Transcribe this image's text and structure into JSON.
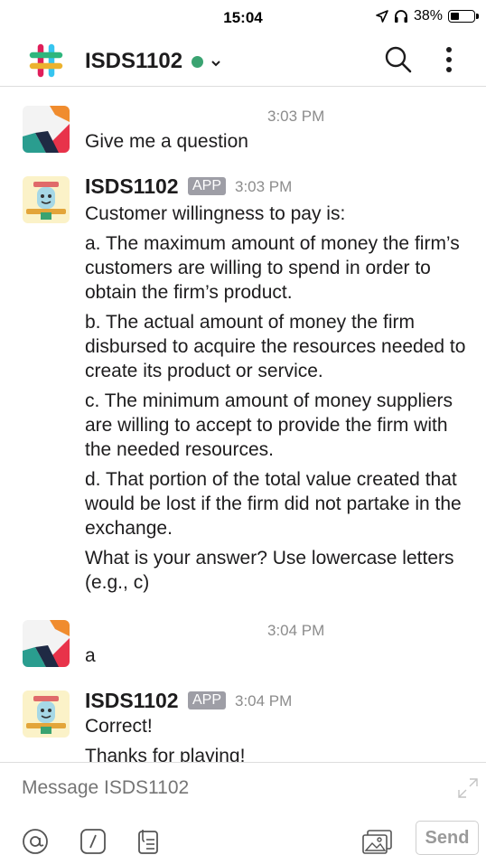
{
  "status_bar": {
    "time": "15:04",
    "battery_text": "38%",
    "battery_level": 0.38,
    "icons": [
      "location-arrow-icon",
      "headphones-icon",
      "battery-icon"
    ]
  },
  "header": {
    "channel_name": "ISDS1102",
    "presence": "online",
    "presence_color": "#3aa371",
    "chevron": "⌄",
    "icons": [
      "slack-logo-icon",
      "chevron-down-icon",
      "search-icon",
      "more-vertical-icon"
    ]
  },
  "messages": [
    {
      "sender": "",
      "time": "3:03 PM",
      "paragraphs": [
        "Give me a question"
      ],
      "avatar": "user-avatar-icon"
    },
    {
      "sender": "ISDS1102",
      "badge": "APP",
      "time": "3:03 PM",
      "avatar": "bot-avatar-icon",
      "paragraphs": [
        "Customer willingness to pay is:",
        "a. The maximum amount of money the firm’s customers are willing to spend in order to obtain the firm’s product.",
        "b. The actual amount of money the firm disbursed to acquire the resources needed to create its product or service.",
        "c. The minimum amount of money suppliers are willing to accept to provide the firm with the needed resources.",
        "d. That portion of the total value created that would be lost if the firm did not partake in the exchange.",
        "What is your answer? Use lowercase letters (e.g., c)"
      ]
    },
    {
      "sender": "",
      "time": "3:04 PM",
      "paragraphs": [
        "a"
      ],
      "avatar": "user-avatar-icon"
    },
    {
      "sender": "ISDS1102",
      "badge": "APP",
      "time": "3:04 PM",
      "avatar": "bot-avatar-icon",
      "paragraphs": [
        "Correct!",
        "Thanks for playing!"
      ]
    }
  ],
  "composer": {
    "placeholder": "Message ISDS1102",
    "send_label": "Send",
    "at_symbol": "@",
    "icons": [
      "at-mention-icon",
      "slash-command-icon",
      "file-attach-icon",
      "image-icon",
      "expand-icon"
    ]
  },
  "colors": {
    "text": "#1d1c1d",
    "muted": "#8c8c8c",
    "badge": "#9e9ea6",
    "divider": "#dddddd"
  }
}
